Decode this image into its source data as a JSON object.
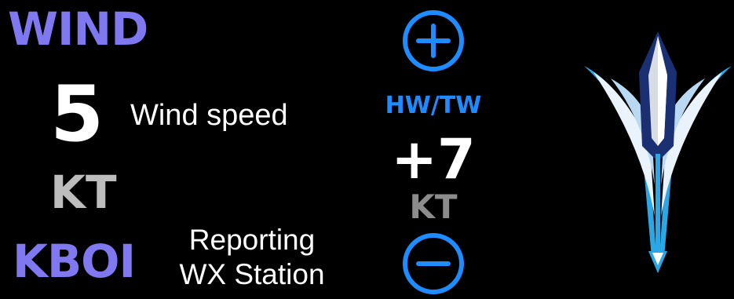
{
  "wind": {
    "title": "WIND",
    "speed": "5",
    "speed_caption": "Wind speed",
    "unit": "KT",
    "station": "KBOI",
    "station_caption_line1": "Reporting",
    "station_caption_line2": "WX Station"
  },
  "component": {
    "label": "HW/TW",
    "value": "+7",
    "unit": "KT",
    "increase_icon": "plus-icon",
    "decrease_icon": "minus-icon"
  },
  "indicator": {
    "icon": "wind-direction-arrow-icon"
  },
  "colors": {
    "background": "#000000",
    "title_purple": "#7f78f0",
    "accent_blue": "#1e8cff",
    "unit_gray": "#bdbdbd",
    "text_white": "#ffffff"
  }
}
